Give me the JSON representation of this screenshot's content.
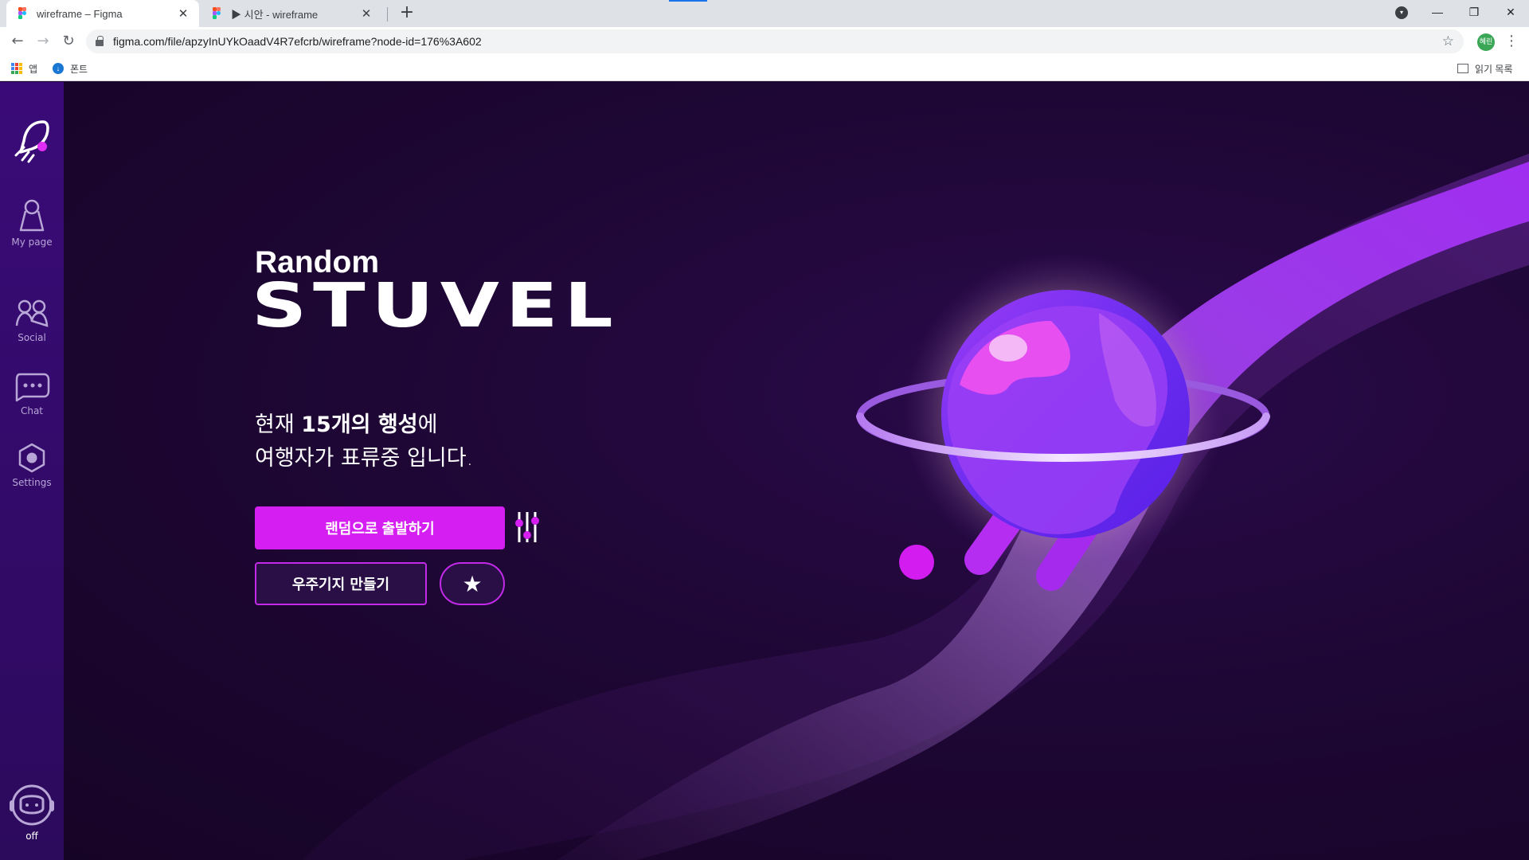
{
  "browser": {
    "tabs": [
      {
        "title": "wireframe – Figma",
        "active": true
      },
      {
        "title": "▶ 시안 - wireframe",
        "active": false
      }
    ],
    "url": "figma.com/file/apzyInUYkOaadV4R7efcrb/wireframe?node-id=176%3A602",
    "profile_initial": "혜린",
    "bookmarks": [
      {
        "label": "앱",
        "icon": "apps-grid-icon"
      },
      {
        "label": "폰트",
        "icon": "bookmark-favicon"
      }
    ],
    "reading_list_label": "읽기 목록"
  },
  "sidebar": {
    "items": [
      {
        "label": "My page",
        "icon": "user-icon"
      },
      {
        "label": "Social",
        "icon": "people-icon"
      },
      {
        "label": "Chat",
        "icon": "chat-bubble-icon"
      },
      {
        "label": "Settings",
        "icon": "hexagon-settings-icon"
      }
    ],
    "status_label": "off",
    "status_icon": "astronaut-helmet-icon"
  },
  "hero": {
    "eyebrow": "Random",
    "title": "STUVEL",
    "desc_prefix": "현재 ",
    "desc_highlight": "15개의 행성",
    "desc_suffix": "에",
    "desc_line2": "여행자가 표류중 입니다."
  },
  "actions": {
    "random_depart": "랜덤으로 출발하기",
    "create_base": "우주기지 만들기",
    "favorite_icon": "star-icon",
    "filter_icon": "sliders-icon"
  },
  "colors": {
    "accent": "#d41ef2",
    "sidebar": "#3a0b78",
    "background": "#1b0630"
  }
}
